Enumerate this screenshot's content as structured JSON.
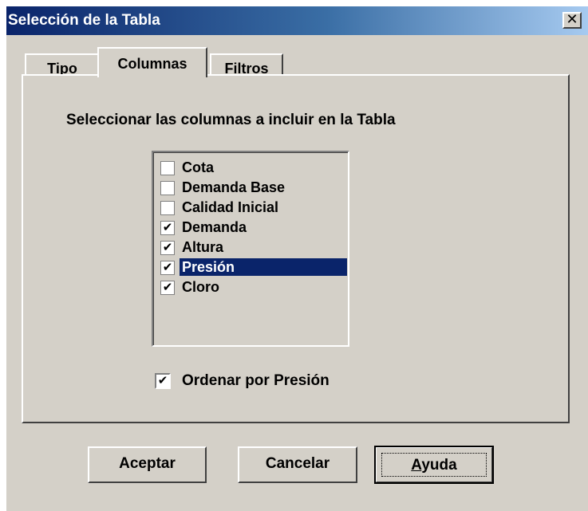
{
  "window": {
    "title": "Selección de la Tabla",
    "close_label": "✕"
  },
  "tabs": [
    {
      "label": "Tipo",
      "active": false
    },
    {
      "label": "Columnas",
      "active": true
    },
    {
      "label": "Filtros",
      "active": false
    }
  ],
  "instruction": "Seleccionar las columnas a incluir en la Tabla",
  "columns": [
    {
      "label": "Cota",
      "checked": false
    },
    {
      "label": "Demanda Base",
      "checked": false
    },
    {
      "label": "Calidad Inicial",
      "checked": false
    },
    {
      "label": "Demanda",
      "checked": true
    },
    {
      "label": "Altura",
      "checked": true
    },
    {
      "label": "Presión",
      "checked": true,
      "selected": true
    },
    {
      "label": "Cloro",
      "checked": true
    }
  ],
  "sort_option": {
    "label": "Ordenar por Presión",
    "checked": true
  },
  "buttons": {
    "ok": "Aceptar",
    "cancel": "Cancelar",
    "help_accel": "A",
    "help_rest": "yuda"
  },
  "colors": {
    "title_bar": "#0a246a",
    "face": "#d4d0c8",
    "selection": "#0a246a"
  },
  "check_mark": "✔"
}
